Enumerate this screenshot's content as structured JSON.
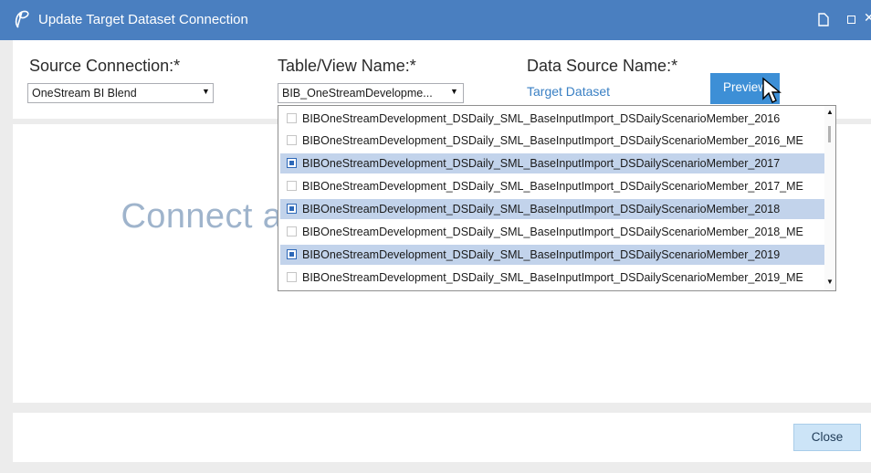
{
  "window": {
    "title": "Update Target Dataset Connection"
  },
  "source_connection": {
    "label": "Source Connection:*",
    "value": "OneStream BI Blend"
  },
  "table_view": {
    "label": "Table/View Name:*",
    "value": "BIB_OneStreamDevelopme..."
  },
  "data_source": {
    "label": "Data Source Name:*",
    "value": "Target Dataset"
  },
  "preview_button": {
    "label": "Preview"
  },
  "dropdown": {
    "items": [
      {
        "label": "BIBOneStreamDevelopment_DSDaily_SML_BaseInputImport_DSDailyScenarioMember_2016",
        "checked": false
      },
      {
        "label": "BIBOneStreamDevelopment_DSDaily_SML_BaseInputImport_DSDailyScenarioMember_2016_ME",
        "checked": false
      },
      {
        "label": "BIBOneStreamDevelopment_DSDaily_SML_BaseInputImport_DSDailyScenarioMember_2017",
        "checked": true
      },
      {
        "label": "BIBOneStreamDevelopment_DSDaily_SML_BaseInputImport_DSDailyScenarioMember_2017_ME",
        "checked": false
      },
      {
        "label": "BIBOneStreamDevelopment_DSDaily_SML_BaseInputImport_DSDailyScenarioMember_2018",
        "checked": true
      },
      {
        "label": "BIBOneStreamDevelopment_DSDaily_SML_BaseInputImport_DSDailyScenarioMember_2018_ME",
        "checked": false
      },
      {
        "label": "BIBOneStreamDevelopment_DSDaily_SML_BaseInputImport_DSDailyScenarioMember_2019",
        "checked": true
      },
      {
        "label": "BIBOneStreamDevelopment_DSDaily_SML_BaseInputImport_DSDailyScenarioMember_2019_ME",
        "checked": false
      }
    ]
  },
  "main": {
    "message": "Connect and Verify Your Data Source(s)"
  },
  "footer": {
    "close_label": "Close"
  },
  "colors": {
    "titlebar": "#4a7fc0",
    "accent": "#3a80c4",
    "selected_row": "#c2d3eb",
    "message": "#9fb4cc"
  },
  "icons": [
    "onestream-logo-icon",
    "document-icon",
    "maximize-icon",
    "close-icon",
    "chevron-down-icon",
    "mouse-cursor-icon"
  ]
}
